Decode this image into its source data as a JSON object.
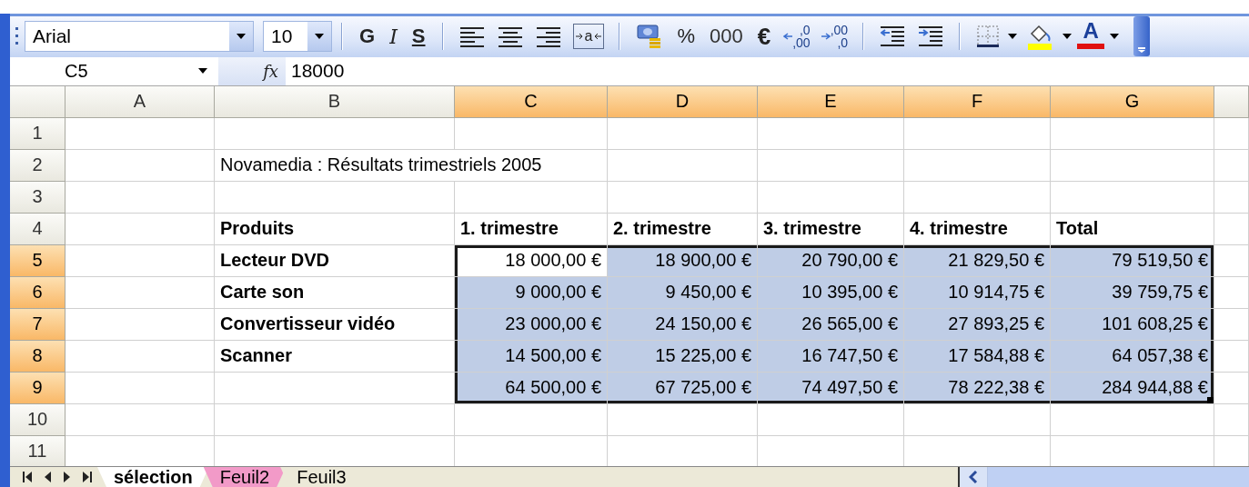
{
  "toolbar": {
    "font": "Arial",
    "size": "10",
    "format_buttons": [
      "G",
      "I",
      "S"
    ],
    "merge_label": "a",
    "number_buttons": [
      "%",
      "000",
      "€"
    ],
    "decimal_buttons": [
      {
        "upper": ",0",
        "lower": ",00"
      },
      {
        "upper": ",00",
        "lower": ",0"
      }
    ],
    "font_color_label": "A"
  },
  "formula_bar": {
    "name_box": "C5",
    "function_label": "fx",
    "value": "18000"
  },
  "columns": [
    {
      "label": "A",
      "selected": false
    },
    {
      "label": "B",
      "selected": false
    },
    {
      "label": "C",
      "selected": true
    },
    {
      "label": "D",
      "selected": true
    },
    {
      "label": "E",
      "selected": true
    },
    {
      "label": "F",
      "selected": true
    },
    {
      "label": "G",
      "selected": true
    }
  ],
  "rows": [
    {
      "label": "1",
      "selected": false,
      "cells": [
        {
          "selected": false
        },
        {
          "selected": false
        },
        {
          "selected": false
        },
        {
          "selected": false
        },
        {
          "selected": false
        },
        {
          "selected": false
        },
        {
          "selected": false
        }
      ]
    },
    {
      "label": "2",
      "selected": false,
      "cells": [
        {
          "selected": false
        },
        {
          "text": "Novamedia : Résultats trimestriels 2005",
          "kind": "text",
          "selected": false
        },
        {
          "selected": false
        },
        {
          "selected": false
        },
        {
          "selected": false
        },
        {
          "selected": false
        }
      ]
    },
    {
      "label": "3",
      "selected": false,
      "cells": [
        {
          "selected": false
        },
        {
          "selected": false
        },
        {
          "selected": false
        },
        {
          "selected": false
        },
        {
          "selected": false
        },
        {
          "selected": false
        },
        {
          "selected": false
        }
      ]
    },
    {
      "label": "4",
      "selected": false,
      "cells": [
        {
          "selected": false
        },
        {
          "text": "Produits",
          "kind": "heading",
          "selected": false
        },
        {
          "text": "1. trimestre",
          "kind": "heading",
          "selected": false
        },
        {
          "text": "2. trimestre",
          "kind": "heading",
          "selected": false
        },
        {
          "text": "3. trimestre",
          "kind": "heading",
          "selected": false
        },
        {
          "text": "4. trimestre",
          "kind": "heading",
          "selected": false
        },
        {
          "text": "Total",
          "kind": "heading",
          "selected": false
        }
      ]
    },
    {
      "label": "5",
      "selected": true,
      "cells": [
        {
          "selected": false
        },
        {
          "text": "Lecteur DVD",
          "kind": "heading",
          "selected": false
        },
        {
          "text": "18 000,00 €",
          "kind": "number",
          "selected": true,
          "active": true
        },
        {
          "text": "18 900,00 €",
          "kind": "number",
          "selected": true,
          "active": false
        },
        {
          "text": "20 790,00 €",
          "kind": "number",
          "selected": true,
          "active": false
        },
        {
          "text": "21 829,50 €",
          "kind": "number",
          "selected": true,
          "active": false
        },
        {
          "text": "79 519,50 €",
          "kind": "number",
          "selected": true,
          "active": false
        }
      ]
    },
    {
      "label": "6",
      "selected": true,
      "cells": [
        {
          "selected": false
        },
        {
          "text": "Carte son",
          "kind": "heading",
          "selected": false
        },
        {
          "text": "9 000,00 €",
          "kind": "number",
          "selected": true,
          "active": false
        },
        {
          "text": "9 450,00 €",
          "kind": "number",
          "selected": true,
          "active": false
        },
        {
          "text": "10 395,00 €",
          "kind": "number",
          "selected": true,
          "active": false
        },
        {
          "text": "10 914,75 €",
          "kind": "number",
          "selected": true,
          "active": false
        },
        {
          "text": "39 759,75 €",
          "kind": "number",
          "selected": true,
          "active": false
        }
      ]
    },
    {
      "label": "7",
      "selected": true,
      "cells": [
        {
          "selected": false
        },
        {
          "text": "Convertisseur vidéo",
          "kind": "heading",
          "selected": false
        },
        {
          "text": "23 000,00 €",
          "kind": "number",
          "selected": true,
          "active": false
        },
        {
          "text": "24 150,00 €",
          "kind": "number",
          "selected": true,
          "active": false
        },
        {
          "text": "26 565,00 €",
          "kind": "number",
          "selected": true,
          "active": false
        },
        {
          "text": "27 893,25 €",
          "kind": "number",
          "selected": true,
          "active": false
        },
        {
          "text": "101 608,25 €",
          "kind": "number",
          "selected": true,
          "active": false
        }
      ]
    },
    {
      "label": "8",
      "selected": true,
      "cells": [
        {
          "selected": false
        },
        {
          "text": "Scanner",
          "kind": "heading",
          "selected": false
        },
        {
          "text": "14 500,00 €",
          "kind": "number",
          "selected": true,
          "active": false
        },
        {
          "text": "15 225,00 €",
          "kind": "number",
          "selected": true,
          "active": false
        },
        {
          "text": "16 747,50 €",
          "kind": "number",
          "selected": true,
          "active": false
        },
        {
          "text": "17 584,88 €",
          "kind": "number",
          "selected": true,
          "active": false
        },
        {
          "text": "64 057,38 €",
          "kind": "number",
          "selected": true,
          "active": false
        }
      ]
    },
    {
      "label": "9",
      "selected": true,
      "cells": [
        {
          "selected": false
        },
        {
          "selected": false
        },
        {
          "text": "64 500,00 €",
          "kind": "number",
          "selected": true,
          "active": false
        },
        {
          "text": "67 725,00 €",
          "kind": "number",
          "selected": true,
          "active": false
        },
        {
          "text": "74 497,50 €",
          "kind": "number",
          "selected": true,
          "active": false
        },
        {
          "text": "78 222,38 €",
          "kind": "number",
          "selected": true,
          "active": false
        },
        {
          "text": "284 944,88 €",
          "kind": "number",
          "selected": true,
          "active": false
        }
      ]
    },
    {
      "label": "10",
      "selected": false,
      "cells": [
        {
          "selected": false
        },
        {
          "selected": false
        },
        {
          "selected": false
        },
        {
          "selected": false
        },
        {
          "selected": false
        },
        {
          "selected": false
        },
        {
          "selected": false
        }
      ]
    },
    {
      "label": "11",
      "selected": false,
      "cells": [
        {
          "selected": false
        },
        {
          "selected": false
        },
        {
          "selected": false
        },
        {
          "selected": false
        },
        {
          "selected": false
        },
        {
          "selected": false
        },
        {
          "selected": false
        }
      ]
    }
  ],
  "sheet_tabs": [
    {
      "label": "sélection",
      "selected": true,
      "color": "#ffffff"
    },
    {
      "label": "Feuil2",
      "selected": false,
      "color": "#f29ac8"
    },
    {
      "label": "Feuil3",
      "selected": false,
      "color": "#ece9d8"
    }
  ]
}
